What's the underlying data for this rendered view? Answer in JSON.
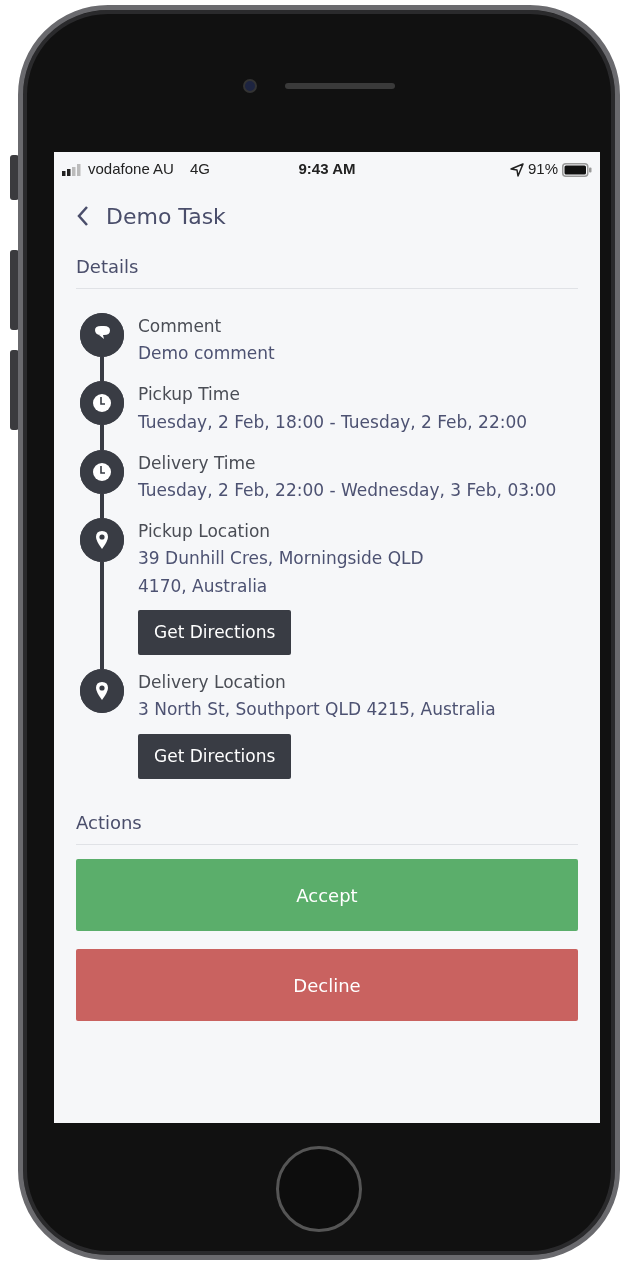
{
  "status_bar": {
    "carrier": "vodafone AU",
    "network": "4G",
    "time": "9:43 AM",
    "battery": "91%"
  },
  "header": {
    "title": "Demo Task"
  },
  "details": {
    "heading": "Details",
    "items": [
      {
        "kind": "comment",
        "label": "Comment",
        "value": "Demo comment"
      },
      {
        "kind": "clock",
        "label": "Pickup Time",
        "value": "Tuesday, 2 Feb, 18:00 - Tuesday, 2 Feb, 22:00"
      },
      {
        "kind": "clock",
        "label": "Delivery Time",
        "value": "Tuesday, 2 Feb, 22:00 - Wednesday, 3 Feb, 03:00"
      },
      {
        "kind": "pin",
        "label": "Pickup Location",
        "value": "39 Dunhill Cres, Morningside QLD\n4170, Australia",
        "button": "Get Directions"
      },
      {
        "kind": "pin",
        "label": "Delivery Location",
        "value": "3 North St, Southport QLD 4215, Australia",
        "button": "Get Directions"
      }
    ]
  },
  "actions": {
    "heading": "Actions",
    "buttons": [
      {
        "kind": "accept",
        "label": "Accept"
      },
      {
        "kind": "decline",
        "label": "Decline"
      }
    ]
  }
}
